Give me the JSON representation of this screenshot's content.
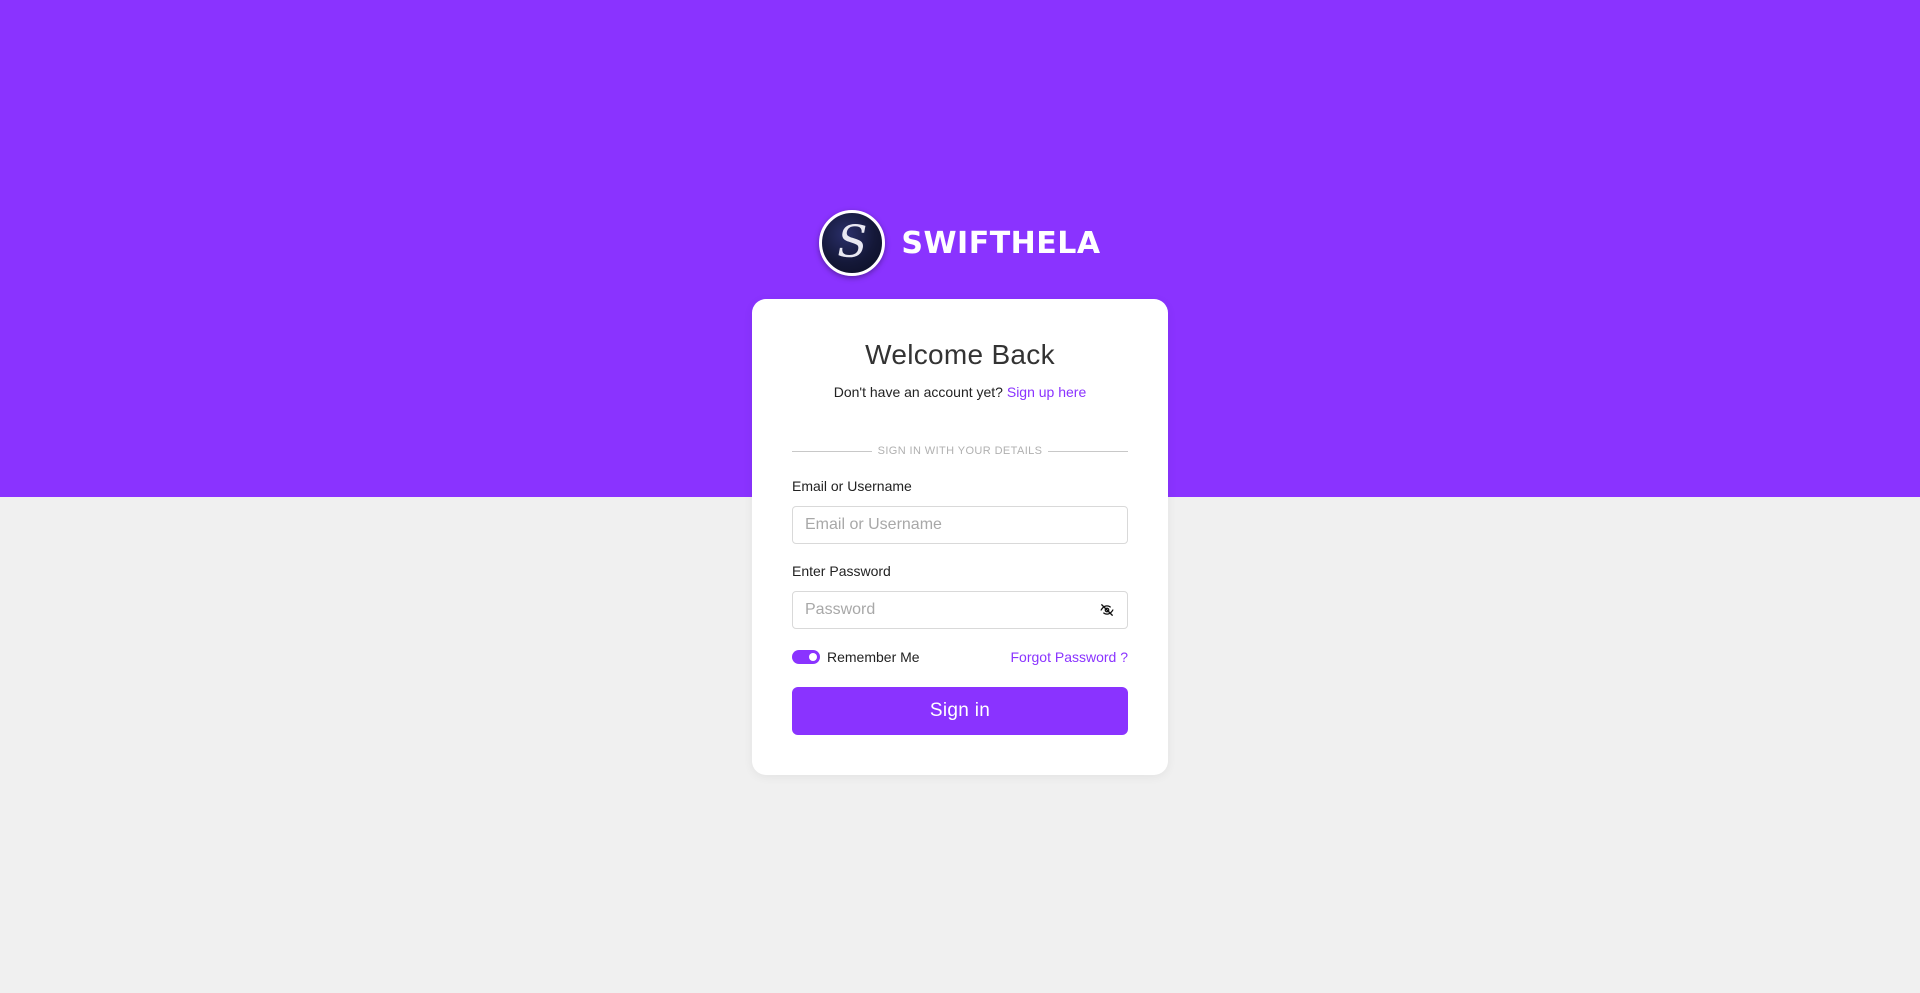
{
  "brand": {
    "logo_letter": "S",
    "name": "SWIFTHELA"
  },
  "colors": {
    "accent": "#8a33ff",
    "background": "#f0f0f0",
    "card": "#ffffff"
  },
  "login": {
    "title": "Welcome Back",
    "signup_prompt": "Don't have an account yet?",
    "signup_link": "Sign up here",
    "divider_text": "SIGN IN WITH YOUR DETAILS",
    "email_label": "Email or Username",
    "email_value": "",
    "email_placeholder": "Email or Username",
    "password_label": "Enter Password",
    "password_value": "",
    "password_placeholder": "Password",
    "password_toggle_icon": "eye-off-icon",
    "remember_label": "Remember Me",
    "remember_checked": true,
    "forgot_link": "Forgot Password ?",
    "submit_label": "Sign in"
  }
}
